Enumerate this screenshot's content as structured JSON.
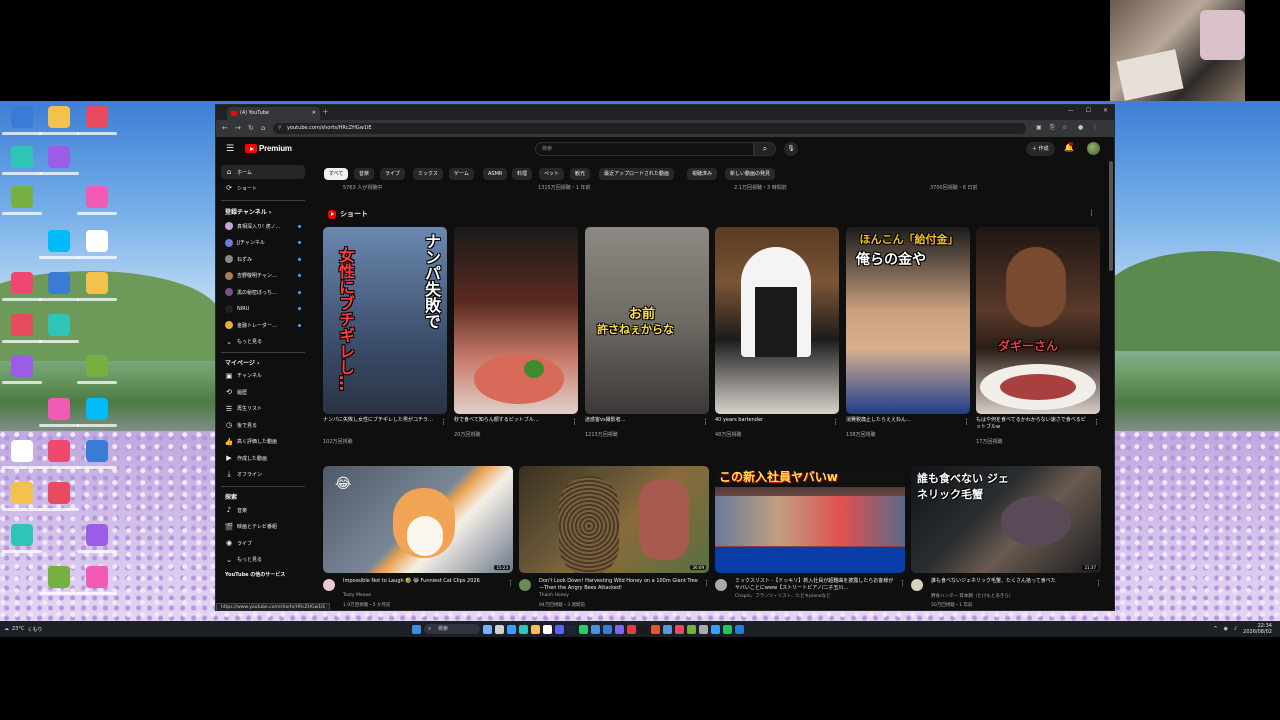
{
  "browser": {
    "tab_title": "(4) YouTube",
    "url": "youtube.com/shorts/HRcZHGw1lE",
    "status_url": "https://www.youtube.com/shorts/HRcZHGw1lE"
  },
  "header": {
    "brand": "Premium",
    "search_placeholder": "検索",
    "create_label": "作成"
  },
  "sidebar": {
    "main": [
      {
        "icon": "home-icon",
        "label": "ホーム",
        "active": true
      },
      {
        "icon": "shorts-icon",
        "label": "ショート",
        "active": false
      }
    ],
    "subs_heading": "登録チャンネル ›",
    "subs": [
      {
        "label": "真相深入り! 虎ノ…",
        "color": "#c9a0d8"
      },
      {
        "label": "JJチャンネル",
        "color": "#6a7fd8"
      },
      {
        "label": "ねずみ",
        "color": "#888888"
      },
      {
        "label": "吉野敬明チャン…",
        "color": "#b07a5a"
      },
      {
        "label": "黒の秘密ぼっち…",
        "color": "#7a4f8a"
      },
      {
        "label": "NIRU",
        "color": "#222222"
      },
      {
        "label": "金融トレーダー…",
        "color": "#e0b030"
      }
    ],
    "subs_more": "もっと見る",
    "you_heading": "マイページ ›",
    "you": [
      {
        "icon": "channel-icon",
        "label": "チャンネル"
      },
      {
        "icon": "history-icon",
        "label": "履歴"
      },
      {
        "icon": "playlist-icon",
        "label": "再生リスト"
      },
      {
        "icon": "watch-later-icon",
        "label": "後で見る"
      },
      {
        "icon": "liked-icon",
        "label": "高く評価した動画"
      },
      {
        "icon": "your-videos-icon",
        "label": "作成した動画"
      },
      {
        "icon": "download-icon",
        "label": "オフライン"
      }
    ],
    "explore_heading": "探索",
    "explore": [
      {
        "icon": "music-icon",
        "label": "音楽"
      },
      {
        "icon": "movies-icon",
        "label": "映画とテレビ番組"
      },
      {
        "icon": "live-icon",
        "label": "ライブ"
      },
      {
        "icon": "more-icon",
        "label": "もっと見る"
      }
    ],
    "footer": "YouTube の他のサービス"
  },
  "chips": [
    "すべて",
    "音楽",
    "ライブ",
    "ミックス",
    "ゲーム",
    "ASMR",
    "料理",
    "ペット",
    "観光",
    "最近アップロードされた動画",
    "視聴済み",
    "新しい動画の発見"
  ],
  "prev_row_meta": [
    "5763 人が視聴中",
    "1315万回視聴・1 年前",
    "2.1万回視聴・3 時間前",
    "3700回視聴・6 日前"
  ],
  "shorts_heading": "ショート",
  "shorts": [
    {
      "title": "ナンパに失敗し女性にブチギレした男がコチラ…",
      "views": "102万回視聴",
      "ov1": "ナンパ失敗で",
      "ov2": "女性にブチギレし…",
      "bg": "linear-gradient(180deg,#6b88b0,#3c4f6c 60%,#2a3345)"
    },
    {
      "title": "秒で食べて知らん顔するピットブル…",
      "views": "20万回視聴",
      "ov1": "",
      "ov2": "",
      "bg": "linear-gradient(180deg,#1a1a1a,#5a2a20 40%,#c77a6a 70%,#e0d0c8)"
    },
    {
      "title": "迷惑客vs撮影者…",
      "views": "1213万回視聴",
      "ov1": "お前",
      "ov2": "許さねぇからな",
      "bg": "linear-gradient(180deg,#8d8a84,#6e6a64 50%,#3b3937)"
    },
    {
      "title": "40 years bartender",
      "views": "48万回視聴",
      "ov1": "",
      "ov2": "",
      "bg": "linear-gradient(180deg,#5a3a22,#7b5535 30%,#1c1c1c 60%,#d8d4cc)"
    },
    {
      "title": "消費税廃止したらええねん…",
      "views": "138万回視聴",
      "ov1": "ほんこん「給付金」",
      "ov2": "俺らの金や",
      "bg": "linear-gradient(180deg,#1c1c1c,#c9a080 45%,#d8b090 65%,#1f3d8a)"
    },
    {
      "title": "もはや何を食べてるかわからない速さで食べるピットブルw",
      "views": "17万回視聴",
      "ov1": "",
      "ov2": "ダギーさん",
      "bg": "linear-gradient(180deg,#1e1612,#5a3a2a 45%,#2a1d16 65%,#d8cfc8)"
    }
  ],
  "videos": [
    {
      "title": "Impossible Not to Laugh 🤣 😹 Funniest Cat Clips 2026",
      "channel": "Tasty Meows",
      "meta": "1.9万回視聴・5 か月前",
      "duration": "15:23",
      "ov": "",
      "bg": "linear-gradient(135deg,#4e5a6a,#7a8796 50%,#e8a050 55%,#f5f0e8 65%,#6b7888)",
      "av": "#e8c8d8"
    },
    {
      "title": "Don't Look Down! Harvesting Wild Honey on a 100m Giant Tree—Then the Angry Bees Attacked!",
      "channel": "Thanh Honey",
      "meta": "94万回視聴・3 週間前",
      "duration": "26:09",
      "ov": "",
      "bg": "linear-gradient(135deg,#3a3020,#6b5a3a 40%,#8a6a3a 55%,#5a7040)",
      "av": "#6a8a5a"
    },
    {
      "title": "ミックスリスト -【ドッキリ】新入社員が超難曲を披露したらお客様がヤバいことにwww【ストリートピアノ/二子玉川…",
      "channel": "Chopin、フランツ・リスト、ヒビキpianoなど",
      "meta": "",
      "duration": "",
      "ov": "この新入社員ヤバいw",
      "bg": "linear-gradient(180deg,#1a1a2a,#8a5a4a 40%,#c05050 60%,#2a2a3a)",
      "av": "#aaaaaa"
    },
    {
      "title": "誰も食べないジェネリック毛蟹、たくさん拾って食べた",
      "channel": "野食ハンター 茸本朗（たけもとあきら）",
      "meta": "50万回視聴・1 年前",
      "duration": "21:37",
      "ov": "誰も食べない ジェネリック毛蟹",
      "bg": "linear-gradient(135deg,#101418,#2a2e30 40%,#6a5a50 60%,#1a1c1e)",
      "av": "#d8d0c0"
    }
  ],
  "taskbar": {
    "weather": "23°C",
    "weather_sub": "くもり",
    "search": "検索",
    "time": "22:34",
    "date": "2026/08/02"
  }
}
